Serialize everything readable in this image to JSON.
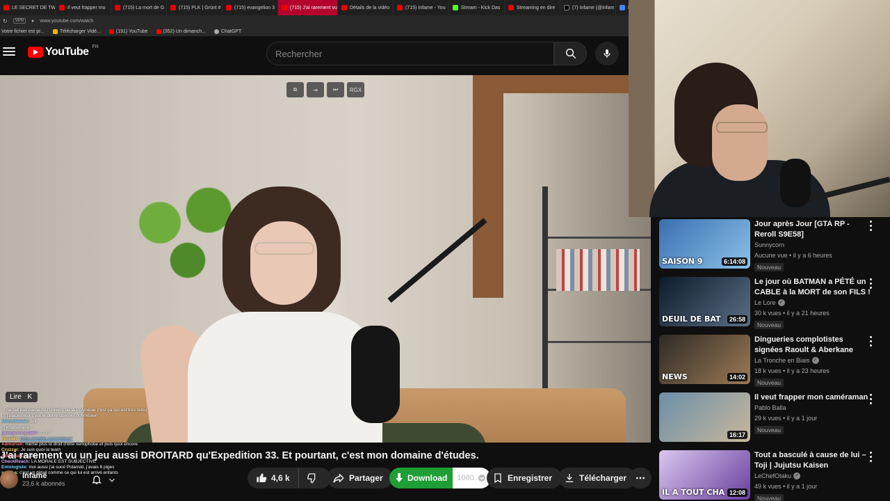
{
  "browser": {
    "tabs": [
      {
        "label": "LE SECRET DE TW",
        "icon": "youtube-favicon"
      },
      {
        "label": "Il veut frapper mo",
        "icon": "youtube-favicon"
      },
      {
        "label": "(715) La mort de G",
        "icon": "youtube-favicon"
      },
      {
        "label": "(715) PLK | Grünt #",
        "icon": "youtube-favicon"
      },
      {
        "label": "(715) evangelion 3",
        "icon": "youtube-favicon"
      },
      {
        "label": "(715) J'ai rarement vu",
        "icon": "youtube-favicon",
        "active": true
      },
      {
        "label": "Détails de la vidéo",
        "icon": "youtube-favicon"
      },
      {
        "label": "(715) Infame - You",
        "icon": "youtube-favicon"
      },
      {
        "label": "Stream - Kick Das",
        "icon": "kick-favicon"
      },
      {
        "label": "Streaming en dire",
        "icon": "youtube-favicon"
      },
      {
        "label": "(7) Infame (@infam",
        "icon": "x-favicon"
      },
      {
        "label": "Pe",
        "icon": "doc-favicon"
      }
    ],
    "url": "www.youtube.com/watch",
    "vpn_label": "VPN",
    "bookmarks": [
      {
        "label": "Votre fichier est pr...",
        "icon": "none"
      },
      {
        "label": "Télécharger Vidé...",
        "icon": "bookmark-icon"
      },
      {
        "label": "(191) YouTube",
        "icon": "youtube-favicon"
      },
      {
        "label": "(352) Un dimanch...",
        "icon": "youtube-favicon"
      },
      {
        "label": "ChatGPT",
        "icon": "chatgpt-icon"
      }
    ]
  },
  "header": {
    "logo_text": "YouTube",
    "region": "FR",
    "search_placeholder": "Rechercher"
  },
  "player": {
    "tools": [
      "pip-icon",
      "exit-icon",
      "skip-icon",
      "RGX"
    ],
    "hint_label": "Lire",
    "hint_key": "K"
  },
  "chat": [
    {
      "user": "",
      "text": "... ne fait pas partie de l'univers de la Polynésie c'est ça qui est très relou",
      "color": "c1"
    },
    {
      "user": "",
      "text": "[...] placés eux c'est le délire guerrier polynésien",
      "color": "c3"
    },
    {
      "user": "shoockaulat:",
      "text": "oui",
      "color": "c1"
    },
    {
      "user": "",
      "text": "@infamebase",
      "color": "c3"
    },
    {
      "user": "georgeshoy1667:",
      "text": "????",
      "color": "c5"
    },
    {
      "user": "cersset:",
      "text": "https://imgflip.com/i/a6oa7",
      "link": true,
      "color": "c4"
    },
    {
      "user": "Admoruill:",
      "text": "même plus le droit d'être xenophobe et puis quoi encore",
      "color": "c2"
    },
    {
      "user": "Cruzzar:",
      "text": "Je suis quoi la team",
      "color": "c4"
    },
    {
      "user": "Admoruill:",
      "text": "ouche",
      "color": "c2"
    },
    {
      "user": "CheckReach:",
      "text": "LA MORALE EST SUBJECTIVE",
      "color": "c5"
    },
    {
      "user": "Entologiste:",
      "text": "moi aussi j'ai sucé Polanski, j'avais 8 piges",
      "color": "c1"
    },
    {
      "user": "sexyha:",
      "text": "c'est un détail comme ce qui lui est arrivé enfants",
      "color": "c3"
    }
  ],
  "video": {
    "title": "J'ai rarement vu un jeu aussi DROITARD qu'Expedition 33. Et pourtant, c'est mon domaine d'études.",
    "channel_name": "Infame",
    "subscribers": "23,6 k abonnés",
    "likes": "4,6 k",
    "share_label": "Partager",
    "download_label": "Download",
    "resolution": "1080",
    "save_label": "Enregistrer",
    "download2_label": "Télécharger"
  },
  "recommendations": [
    {
      "title": "Jour après Jour [GTA RP - Reroll S9E58]",
      "channel": "Sunnycorn",
      "verified": false,
      "meta": "Aucune vue • il y a 6 heures",
      "badge": "Nouveau",
      "duration": "6:14:08",
      "thumb_caption": "SAISON 9",
      "colors": [
        "#3a6fb0",
        "#8ac1e8"
      ]
    },
    {
      "title": "Le jour où BATMAN a PÉTÉ un CABLE à la MORT de son FILS !",
      "channel": "Le Lore",
      "verified": true,
      "meta": "30 k vues • il y a 21 heures",
      "badge": "Nouveau",
      "duration": "26:58",
      "thumb_caption": "DEUIL DE BAT",
      "colors": [
        "#0d1b2a",
        "#5b6f86"
      ]
    },
    {
      "title": "Dingueries complotistes signées Raoult & Aberkane",
      "channel": "La Tronche en Biais",
      "verified": true,
      "meta": "18 k vues • il y a 23 heures",
      "badge": "Nouveau",
      "duration": "14:02",
      "thumb_caption": "NEWS",
      "colors": [
        "#2e2a26",
        "#9c7a55"
      ]
    },
    {
      "title": "Il veut frapper mon caméraman",
      "channel": "Pablo Balla",
      "verified": false,
      "meta": "29 k vues • il y a 1 jour",
      "badge": "Nouveau",
      "duration": "16:17",
      "thumb_caption": "",
      "colors": [
        "#6b8fa8",
        "#c9b79c"
      ]
    },
    {
      "title": "Tout a basculé à cause de lui – Toji | Jujutsu Kaisen",
      "channel": "LeChefOtaku",
      "verified": true,
      "meta": "49 k vues • il y a 1 jour",
      "badge": "Nouveau",
      "duration": "12:08",
      "thumb_caption": "IL A TOUT CHA",
      "colors": [
        "#d9c7ef",
        "#6a3f9e"
      ]
    }
  ]
}
